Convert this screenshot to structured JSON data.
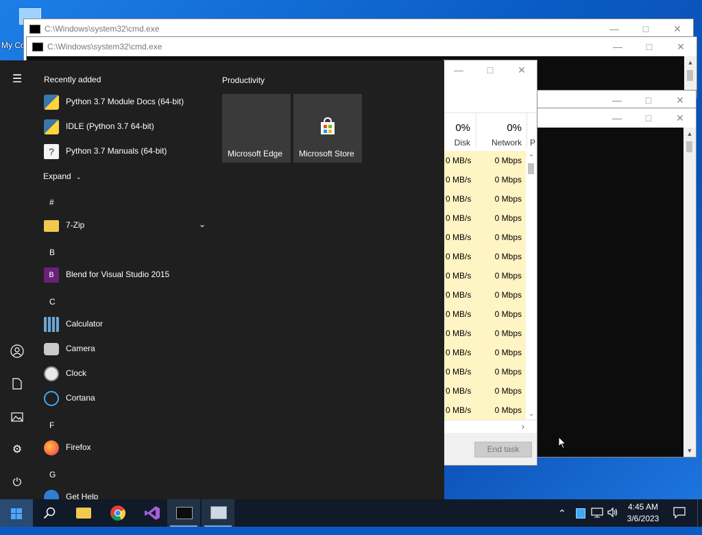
{
  "desktop": {
    "icon_label": "My Co"
  },
  "cmd1": {
    "title": "C:\\Windows\\system32\\cmd.exe"
  },
  "cmd2": {
    "title": "C:\\Windows\\system32\\cmd.exe"
  },
  "taskmanager": {
    "columns": [
      {
        "pct": "0%",
        "label": "Disk"
      },
      {
        "pct": "0%",
        "label": "Network"
      },
      {
        "pct": "",
        "label": "P"
      }
    ],
    "rows": [
      {
        "disk": "0 MB/s",
        "network": "0 Mbps"
      },
      {
        "disk": "0 MB/s",
        "network": "0 Mbps"
      },
      {
        "disk": "0 MB/s",
        "network": "0 Mbps"
      },
      {
        "disk": "0 MB/s",
        "network": "0 Mbps"
      },
      {
        "disk": "0 MB/s",
        "network": "0 Mbps"
      },
      {
        "disk": "0 MB/s",
        "network": "0 Mbps"
      },
      {
        "disk": "0 MB/s",
        "network": "0 Mbps"
      },
      {
        "disk": "0 MB/s",
        "network": "0 Mbps"
      },
      {
        "disk": "0 MB/s",
        "network": "0 Mbps"
      },
      {
        "disk": "0 MB/s",
        "network": "0 Mbps"
      },
      {
        "disk": "0 MB/s",
        "network": "0 Mbps"
      },
      {
        "disk": "0 MB/s",
        "network": "0 Mbps"
      },
      {
        "disk": "0 MB/s",
        "network": "0 Mbps"
      },
      {
        "disk": "0 MB/s",
        "network": "0 Mbps"
      }
    ],
    "end_task": "End task"
  },
  "start_menu": {
    "recently_added": "Recently added",
    "productivity": "Productivity",
    "recent_apps": [
      {
        "name": "Python 3.7 Module Docs (64-bit)",
        "icon": "python-docs-icon"
      },
      {
        "name": "IDLE (Python 3.7 64-bit)",
        "icon": "idle-icon"
      },
      {
        "name": "Python 3.7 Manuals (64-bit)",
        "icon": "python-manual-icon"
      }
    ],
    "expand": "Expand",
    "groups": {
      "hash": "#",
      "b": "B",
      "c": "C",
      "f": "F",
      "g": "G"
    },
    "apps": {
      "zip": "7-Zip",
      "blend": "Blend for Visual Studio 2015",
      "calculator": "Calculator",
      "camera": "Camera",
      "clock": "Clock",
      "cortana": "Cortana",
      "firefox": "Firefox",
      "gethelp": "Get Help"
    },
    "tiles": [
      {
        "name": "Microsoft Edge",
        "icon": "edge-icon"
      },
      {
        "name": "Microsoft Store",
        "icon": "store-icon"
      }
    ]
  },
  "taskbar": {
    "time": "4:45 AM",
    "date": "3/6/2023"
  }
}
